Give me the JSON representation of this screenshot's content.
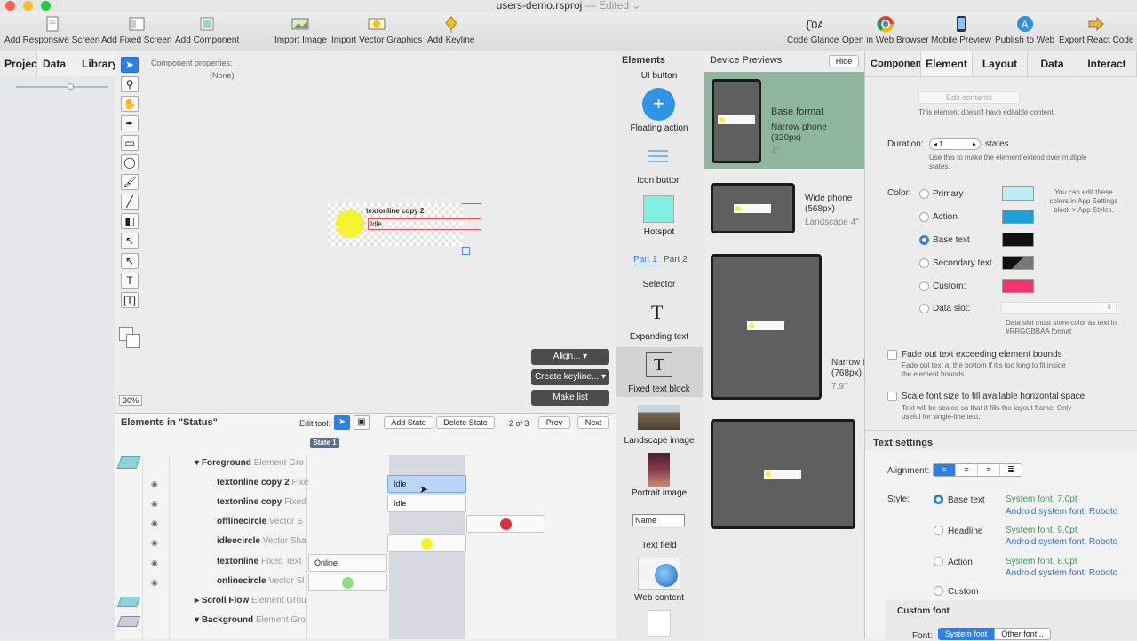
{
  "window": {
    "title": "users-demo.rsproj",
    "edited": " — Edited ⌄"
  },
  "toolbar": {
    "left": [
      "Add Responsive Screen",
      "Add Fixed Screen",
      "Add Component",
      "Import Image",
      "Import Vector Graphics",
      "Add Keyline"
    ],
    "right": [
      "Code Glance",
      "Open in Web Browser",
      "Mobile Preview",
      "Publish to Web",
      "Export React Code"
    ]
  },
  "left_tabs": [
    "Project",
    "Data",
    "Library"
  ],
  "component_props": {
    "label": "Component properties:",
    "value": "(None)"
  },
  "canvas": {
    "element_label": "textonline copy 2",
    "element_text": "Idle",
    "zoom": "30%",
    "buttons": [
      "Align...",
      "Create keyline...",
      "Make list"
    ]
  },
  "elements_table": {
    "title": "Elements in \"Status\"",
    "edit_tool": "Edit tool:",
    "add_state": "Add State",
    "delete_state": "Delete State",
    "state_count": "2 of 3",
    "prev": "Prev",
    "next": "Next",
    "state_badge": "State 1",
    "rows": [
      {
        "name": "Foreground",
        "type": "Element Gro"
      },
      {
        "name": "textonline copy 2",
        "type": "Fixe"
      },
      {
        "name": "textonline copy",
        "type": "Fixed"
      },
      {
        "name": "offlinecircle",
        "type": "Vector S"
      },
      {
        "name": "idleecircle",
        "type": "Vector Sha"
      },
      {
        "name": "textonline",
        "type": "Fixed Text"
      },
      {
        "name": "onlinecircle",
        "type": "Vector Sl"
      },
      {
        "name": "Scroll Flow",
        "type": "Element Grou"
      },
      {
        "name": "Background",
        "type": "Element Gro"
      }
    ],
    "cells": {
      "idle1": "Idle",
      "idle2": "Idle",
      "online": "Online"
    }
  },
  "elements_panel": {
    "title": "Elements",
    "items": [
      "UI button",
      "Floating action",
      "Icon button",
      "Hotspot",
      "Selector",
      "Expanding text",
      "Fixed text block",
      "Landscape image",
      "Portrait image",
      "Text field",
      "Web content"
    ],
    "part1": "Part 1",
    "part2": "Part 2",
    "name_field": "Name"
  },
  "device_previews": {
    "title": "Device Previews",
    "hide": "Hide",
    "devices": [
      {
        "name": "Base format",
        "line1": "Narrow phone",
        "line2": "(320px)",
        "line3": "4\""
      },
      {
        "line1": "Wide phone",
        "line2": "(568px)",
        "line3": "Landscape 4\""
      },
      {
        "line1": "Narrow t",
        "line2": "(768px)",
        "line3": "7.9\""
      }
    ]
  },
  "inspector": {
    "tabs": [
      "Componen",
      "Element",
      "Layout",
      "Data",
      "Interact"
    ],
    "edit_contents": "Edit contents",
    "no_edit": "This element doesn't have editable content.",
    "duration_label": "Duration:",
    "duration_value": "1",
    "states": "states",
    "duration_help": "Use this to make the element extend over multiple states.",
    "color_label": "Color:",
    "colors": [
      {
        "name": "Primary",
        "hex": "#bfeef4"
      },
      {
        "name": "Action",
        "hex": "#1ea0d6"
      },
      {
        "name": "Base text",
        "hex": "#111111"
      },
      {
        "name": "Secondary text",
        "hex": "#555555"
      },
      {
        "name": "Custom:",
        "hex": "#f0356f"
      },
      {
        "name": "Data slot:",
        "hex": ""
      }
    ],
    "colors_note": "You can edit these colors in App Settings block > App Styles.",
    "data_slot_note": "Data slot must store color as text in #RRGGBBAA format",
    "fade_label": "Fade out text exceeding element bounds",
    "fade_help": "Fade out text at the bottom if it's too long to fit inside the element bounds.",
    "scale_label": "Scale font size to fill available horizontal space",
    "scale_help": "Text will be scaled so that it fills the layout frame. Only useful for single-line text.",
    "text_settings": "Text settings",
    "alignment": "Alignment:",
    "style_label": "Style:",
    "styles": [
      {
        "name": "Base text",
        "font": "System font,  7.0pt",
        "android": "Android system font: Roboto"
      },
      {
        "name": "Headline",
        "font": "System font,  9.0pt",
        "android": "Android system font: Roboto"
      },
      {
        "name": "Action",
        "font": "System font,  8.0pt",
        "android": "Android system font: Roboto"
      },
      {
        "name": "Custom",
        "font": "",
        "android": ""
      }
    ],
    "custom_font": "Custom font",
    "font_label": "Font:",
    "font_system": "System font",
    "font_other": "Other font..."
  }
}
